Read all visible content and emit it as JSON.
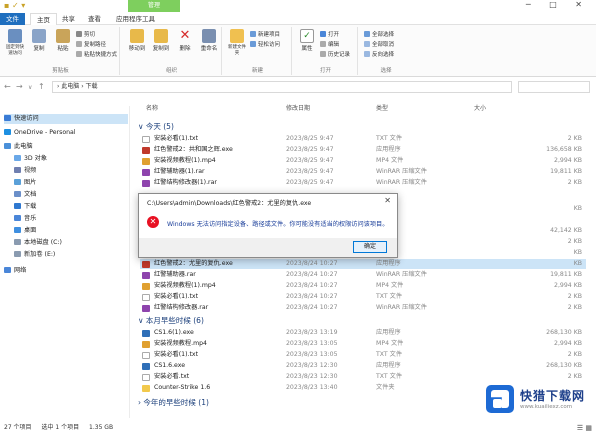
{
  "titlebar": {
    "context_tab": "管理",
    "folder": "下载"
  },
  "tabs": [
    "文件",
    "主页",
    "共享",
    "查看",
    "应用程序工具"
  ],
  "ribbon": {
    "clipboard": {
      "pin": "固定到快速访问",
      "copy": "复制",
      "paste": "粘贴",
      "cut": "剪切",
      "copy_path": "复制路径",
      "paste_shortcut": "粘贴快捷方式",
      "label": "剪贴板"
    },
    "organize": {
      "move_to": "移动到",
      "copy_to": "复制到",
      "delete": "删除",
      "rename": "重命名",
      "label": "组织"
    },
    "new": {
      "new_folder": "新建文件夹",
      "new_item": "新建项目",
      "easy_access": "轻松访问",
      "label": "新建"
    },
    "open": {
      "properties": "属性",
      "open": "打开",
      "edit": "编辑",
      "history": "历史记录",
      "label": "打开"
    },
    "select": {
      "select_all": "全部选择",
      "select_none": "全部取消",
      "invert": "反向选择",
      "label": "选择"
    }
  },
  "address": {
    "path": "› 此电脑 › 下载"
  },
  "nav": {
    "items": [
      {
        "label": "快速访问",
        "color": "#3a7bd5"
      },
      {
        "label": "OneDrive - Personal",
        "color": "#1d8fe1"
      },
      {
        "label": "此电脑",
        "color": "#4a90d9"
      },
      {
        "label": "3D 对象",
        "color": "#6aa8e8"
      },
      {
        "label": "视频",
        "color": "#6f7fb0"
      },
      {
        "label": "图片",
        "color": "#5aa0d8"
      },
      {
        "label": "文档",
        "color": "#6b8fc9"
      },
      {
        "label": "下载",
        "color": "#2f78d0"
      },
      {
        "label": "音乐",
        "color": "#4a86d8"
      },
      {
        "label": "桌面",
        "color": "#3f8fe0"
      },
      {
        "label": "本地磁盘 (C:)",
        "color": "#8a9bb0"
      },
      {
        "label": "新加卷 (E:)",
        "color": "#8a9bb0"
      },
      {
        "label": "网络",
        "color": "#4a86d8"
      }
    ]
  },
  "columns": {
    "name": "名称",
    "date": "修改日期",
    "type": "类型",
    "size": "大小"
  },
  "groups": {
    "today": "今天 (5)",
    "earlier_month": "本月早些时候 (6)",
    "earlier_year": "今年的早些时候 (1)"
  },
  "files_today": [
    {
      "name": "安装必看(1).txt",
      "date": "2023/8/25 9:47",
      "type": "TXT 文件",
      "size": "2 KB",
      "color": "#ffffff"
    },
    {
      "name": "红色警戒2：共和国之辉.exe",
      "date": "2023/8/25 9:47",
      "type": "应用程序",
      "size": "136,658 KB",
      "color": "#c0392b"
    },
    {
      "name": "安装视频教程(1).mp4",
      "date": "2023/8/25 9:47",
      "type": "MP4 文件",
      "size": "2,994 KB",
      "color": "#e0a030"
    },
    {
      "name": "红警辅助器(1).rar",
      "date": "2023/8/25 9:47",
      "type": "WinRAR 压缩文件",
      "size": "19,811 KB",
      "color": "#8e44ad"
    },
    {
      "name": "红警结构修改器(1).rar",
      "date": "2023/8/25 9:47",
      "type": "WinRAR 压缩文件",
      "size": "2 KB",
      "color": "#8e44ad"
    }
  ],
  "files_hidden": [
    {
      "name": "",
      "date": "",
      "type": "",
      "size": "KB"
    },
    {
      "name": "",
      "date": "",
      "type": "",
      "size": "42,142 KB"
    },
    {
      "name": "",
      "date": "",
      "type": "",
      "size": "2 KB"
    },
    {
      "name": "",
      "date": "",
      "type": "",
      "size": "KB"
    }
  ],
  "files_selected": {
    "name": "红色警戒2：尤里的复仇.exe",
    "date": "2023/8/24 10:27",
    "type": "应用程序",
    "size": "KB",
    "color": "#c0392b"
  },
  "files_mid": [
    {
      "name": "红警辅助器.rar",
      "date": "2023/8/24 10:27",
      "type": "WinRAR 压缩文件",
      "size": "19,811 KB",
      "color": "#8e44ad"
    },
    {
      "name": "安装视频教程(1).mp4",
      "date": "2023/8/24 10:27",
      "type": "MP4 文件",
      "size": "2,994 KB",
      "color": "#e0a030"
    },
    {
      "name": "安装必看(1).txt",
      "date": "2023/8/24 10:27",
      "type": "TXT 文件",
      "size": "2 KB",
      "color": "#ffffff"
    },
    {
      "name": "红警结构修改器.rar",
      "date": "2023/8/24 10:27",
      "type": "WinRAR 压缩文件",
      "size": "2 KB",
      "color": "#8e44ad"
    }
  ],
  "files_month": [
    {
      "name": "CS1.6(1).exe",
      "date": "2023/8/23 13:19",
      "type": "应用程序",
      "size": "268,130 KB",
      "color": "#2f6fb8"
    },
    {
      "name": "安装视频教程.mp4",
      "date": "2023/8/23 13:05",
      "type": "MP4 文件",
      "size": "2,994 KB",
      "color": "#e0a030"
    },
    {
      "name": "安装必看(1).txt",
      "date": "2023/8/23 13:05",
      "type": "TXT 文件",
      "size": "2 KB",
      "color": "#ffffff"
    },
    {
      "name": "CS1.6.exe",
      "date": "2023/8/23 12:30",
      "type": "应用程序",
      "size": "268,130 KB",
      "color": "#2f6fb8"
    },
    {
      "name": "安装必看.txt",
      "date": "2023/8/23 12:30",
      "type": "TXT 文件",
      "size": "2 KB",
      "color": "#ffffff"
    },
    {
      "name": "Counter-Strike 1.6",
      "date": "2023/8/23 13:40",
      "type": "文件夹",
      "size": "",
      "color": "#f2c94c"
    }
  ],
  "dialog": {
    "title": "C:\\Users\\admin\\Downloads\\红色警戒2：尤里的复仇.exe",
    "message": "Windows 无法访问指定设备、路径或文件。你可能没有适当的权限访问该项目。",
    "ok": "确定"
  },
  "status": {
    "count": "27 个项目",
    "selected": "选中 1 个项目",
    "size": "1.35 GB"
  },
  "logo": {
    "name": "快猎下载网",
    "url": "www.kuailiexz.com"
  }
}
